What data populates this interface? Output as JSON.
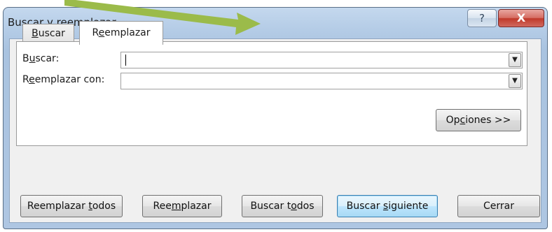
{
  "window": {
    "title": "Buscar y reemplazar",
    "help_glyph": "?",
    "close_glyph": "X"
  },
  "tabs": [
    {
      "pre": "",
      "ul": "B",
      "post": "uscar",
      "active": false
    },
    {
      "pre": "R",
      "ul": "e",
      "post": "emplazar",
      "active": true
    }
  ],
  "fields": {
    "find_label": {
      "pre": "B",
      "ul": "u",
      "post": "scar:"
    },
    "find_value": "",
    "replace_label": {
      "pre": "R",
      "ul": "e",
      "post": "emplazar con:"
    },
    "replace_value": ""
  },
  "options_button": {
    "pre": "Op",
    "ul": "c",
    "post": "iones >>"
  },
  "buttons": {
    "replace_all": {
      "pre": "Reemplazar ",
      "ul": "t",
      "post": "odos"
    },
    "replace": {
      "pre": "Ree",
      "ul": "m",
      "post": "plazar"
    },
    "find_all": {
      "pre": "Buscar t",
      "ul": "o",
      "post": "dos"
    },
    "find_next": {
      "pre": "Buscar ",
      "ul": "s",
      "post": "iguiente"
    },
    "close": "Cerrar"
  },
  "annotation_arrow_color": "#9bbb4a",
  "dropdown_glyph": "▼"
}
